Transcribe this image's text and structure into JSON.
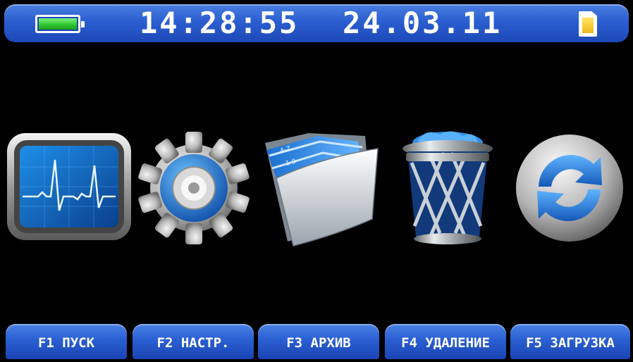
{
  "status_bar": {
    "battery_level": 1.0,
    "time": "14:28:55",
    "date": "24.03.11",
    "battery_color": "#2cc42c",
    "sd_card_color": "#f2b71a"
  },
  "icons": [
    {
      "name": "monitor-ecg-icon"
    },
    {
      "name": "settings-gear-icon"
    },
    {
      "name": "archive-folder-icon"
    },
    {
      "name": "trash-bin-icon"
    },
    {
      "name": "refresh-icon"
    }
  ],
  "function_keys": [
    {
      "label": "F1 ПУСК"
    },
    {
      "label": "F2 НАСТР."
    },
    {
      "label": "F3 АРХИВ"
    },
    {
      "label": "F4 УДАЛЕНИЕ"
    },
    {
      "label": "F5 ЗАГРУЗКА"
    }
  ],
  "colors": {
    "bar_blue": "#2b5ed0",
    "background": "#000000",
    "icon_blue": "#2f8fe6"
  }
}
